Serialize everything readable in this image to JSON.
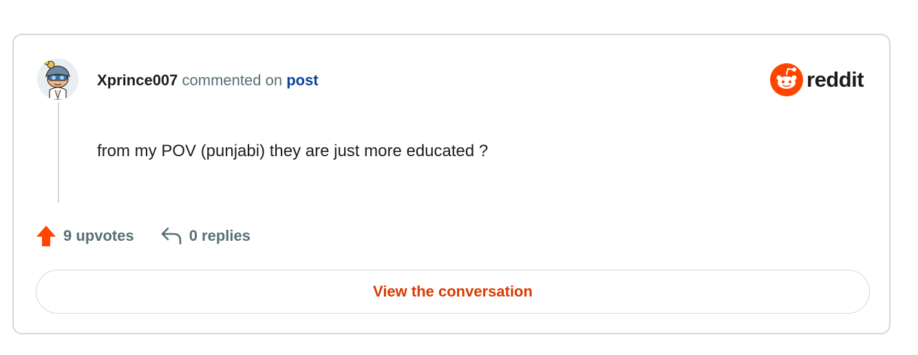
{
  "comment": {
    "author": "Xprince007",
    "action_text": "commented on",
    "post_link_label": "post",
    "body": "from my POV (punjabi) they are just more educated ?",
    "upvotes_label": "9 upvotes",
    "replies_label": "0 replies"
  },
  "brand": {
    "wordmark": "reddit",
    "accent_color": "#ff4500"
  },
  "actions": {
    "view_conversation_label": "View the conversation"
  },
  "icons": {
    "avatar": "snoo-avatar-icon",
    "logo": "reddit-logo-icon",
    "upvote": "upvote-arrow-icon",
    "reply": "reply-arrow-icon"
  }
}
